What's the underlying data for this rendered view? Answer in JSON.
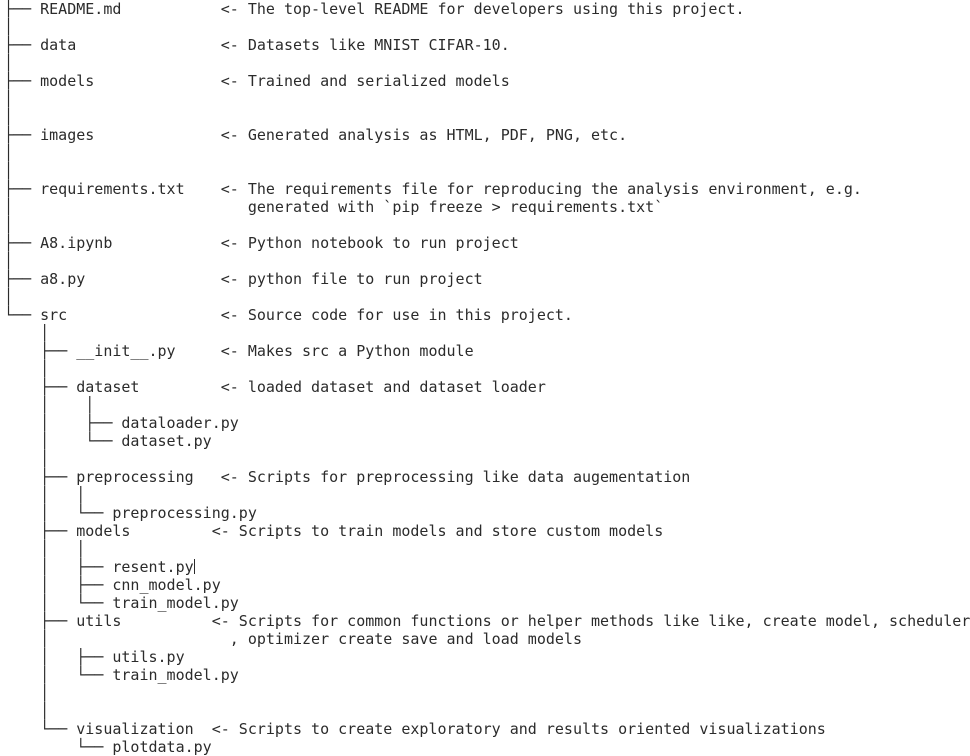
{
  "lines": [
    "├── README.md           <- The top-level README for developers using this project.",
    "│",
    "├── data                <- Datasets like MNIST CIFAR-10.",
    "│",
    "├── models              <- Trained and serialized models",
    "│",
    "│",
    "├── images              <- Generated analysis as HTML, PDF, PNG, etc.",
    "│",
    "│",
    "├── requirements.txt    <- The requirements file for reproducing the analysis environment, e.g.",
    "│                          generated with `pip freeze > requirements.txt`",
    "│",
    "├── A8.ipynb            <- Python notebook to run project",
    "│",
    "├── a8.py               <- python file to run project",
    "│",
    "└── src                 <- Source code for use in this project.",
    "    │",
    "    ├── __init__.py     <- Makes src a Python module",
    "    │",
    "    ├── dataset         <- loaded dataset and dataset loader",
    "    │    │",
    "    │    ├── dataloader.py",
    "    │    └── dataset.py",
    "    │",
    "    ├── preprocessing   <- Scripts for preprocessing like data augementation",
    "    │   │",
    "    │   └── preprocessing.py",
    "    ├── models         <- Scripts to train models and store custom models",
    "    │   │",
    "    │   ├── resent.py",
    "    │   ├── cnn_model.py",
    "    │   └── train_model.py",
    "    ├── utils          <- Scripts for common functions or helper methods like like, create model, scheduler",
    "    │                    , optimizer create save and load models",
    "    │   ├── utils.py",
    "    │   └── train_model.py",
    "    │",
    "    │",
    "    └── visualization  <- Scripts to create exploratory and results oriented visualizations",
    "        └── plotdata.py"
  ],
  "cursor_line": 31
}
